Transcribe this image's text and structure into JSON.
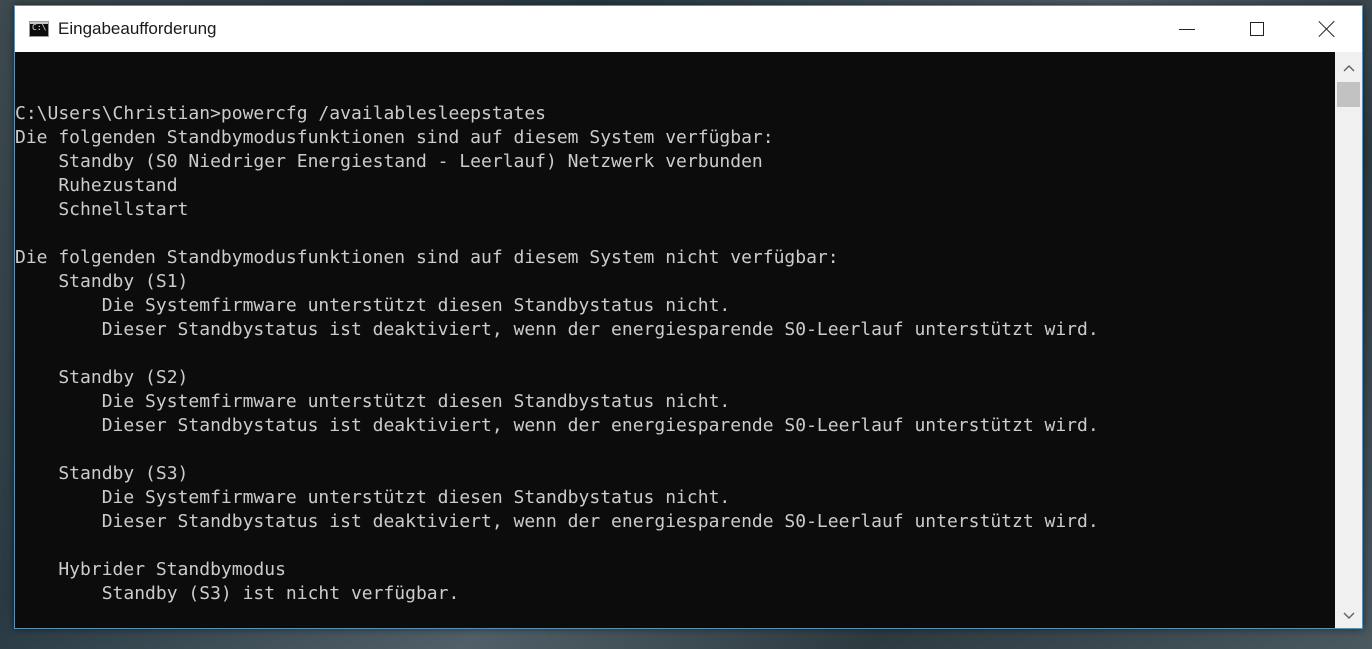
{
  "window": {
    "title": "Eingabeaufforderung",
    "icon_text": "C:\\."
  },
  "console": {
    "lines": [
      "C:\\Users\\Christian>powercfg /availablesleepstates",
      "Die folgenden Standbymodusfunktionen sind auf diesem System verfügbar:",
      "    Standby (S0 Niedriger Energiestand - Leerlauf) Netzwerk verbunden",
      "    Ruhezustand",
      "    Schnellstart",
      "",
      "Die folgenden Standbymodusfunktionen sind auf diesem System nicht verfügbar:",
      "    Standby (S1)",
      "        Die Systemfirmware unterstützt diesen Standbystatus nicht.",
      "        Dieser Standbystatus ist deaktiviert, wenn der energiesparende S0-Leerlauf unterstützt wird.",
      "",
      "    Standby (S2)",
      "        Die Systemfirmware unterstützt diesen Standbystatus nicht.",
      "        Dieser Standbystatus ist deaktiviert, wenn der energiesparende S0-Leerlauf unterstützt wird.",
      "",
      "    Standby (S3)",
      "        Die Systemfirmware unterstützt diesen Standbystatus nicht.",
      "        Dieser Standbystatus ist deaktiviert, wenn der energiesparende S0-Leerlauf unterstützt wird.",
      "",
      "    Hybrider Standbymodus",
      "        Standby (S3) ist nicht verfügbar."
    ]
  },
  "icons": {
    "app": "terminal-icon",
    "minimize": "minimize-icon",
    "maximize": "maximize-icon",
    "close": "close-icon",
    "scroll_up": "chevron-up-icon",
    "scroll_down": "chevron-down-icon"
  },
  "colors": {
    "console_bg": "#0c0c0c",
    "console_fg": "#cccccc",
    "titlebar_bg": "#ffffff",
    "window_border": "#5a8fb8"
  }
}
